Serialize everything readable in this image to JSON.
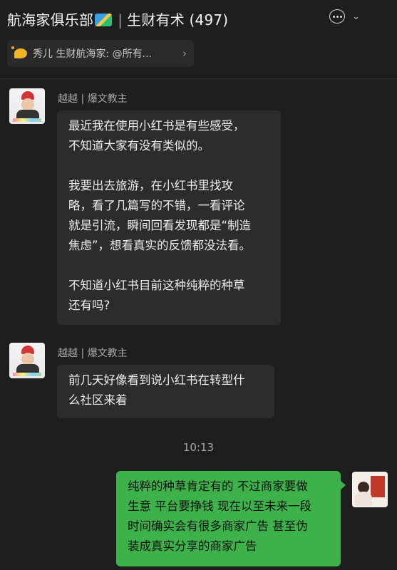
{
  "header": {
    "group_name": "航海家俱乐部",
    "separator": "|",
    "subgroup": "生财有术 (497)",
    "more_icon": "more-dots-icon",
    "chevron_icon": "chevron-down-icon"
  },
  "notice": {
    "text": "秀儿 生财航海家: @所有...",
    "arrow": "›",
    "icon": "announcement-icon"
  },
  "messages": [
    {
      "sender": "越越 | 爆文教主",
      "paragraphs": [
        "最近我在使用小红书是有些感受，\n不知道大家有没有类似的。",
        "我要出去旅游，在小红书里找攻\n略，看了几篇写的不错，一看评论\n就是引流，瞬间回看发现都是“制造\n焦虑”，想看真实的反馈都没法看。",
        "不知道小红书目前这种纯粹的种草\n还有吗?"
      ]
    },
    {
      "sender": "越越 | 爆文教主",
      "text": "前几天好像看到说小红书在转型什\n么社区来着"
    },
    {
      "time": "10:13"
    },
    {
      "self": true,
      "text": "纯粹的种草肯定有的 不过商家要做\n生意 平台要挣钱 现在以至未来一段\n时间确实会有很多商家广告 甚至伪\n装成真实分享的商家广告"
    }
  ],
  "colors": {
    "background": "#1e1e1e",
    "bubble_other": "#2c2c2c",
    "bubble_self": "#3db24a"
  }
}
